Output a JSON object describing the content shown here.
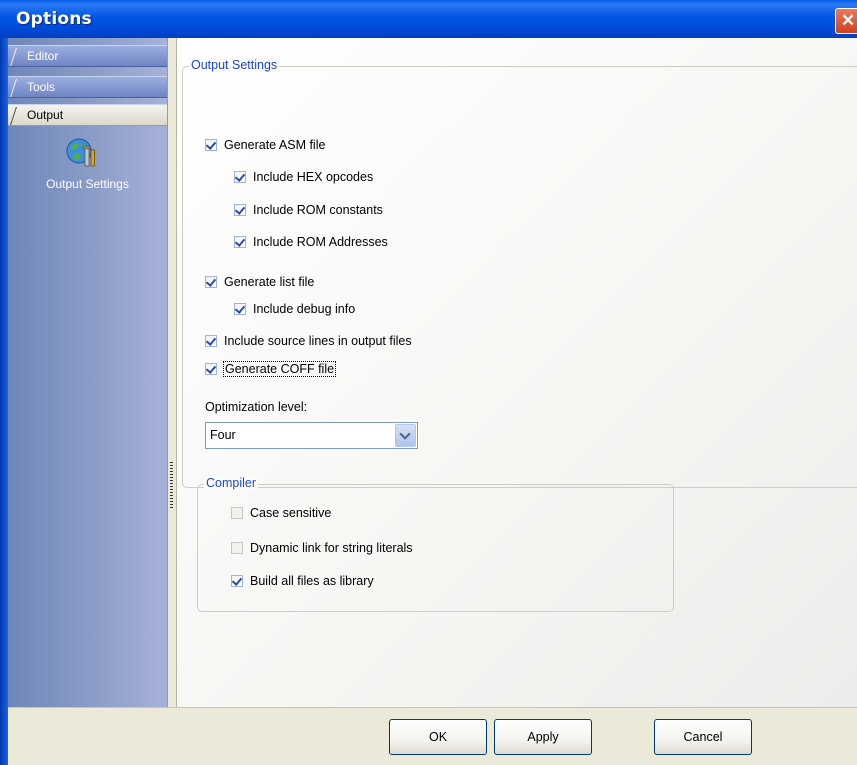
{
  "window": {
    "title": "Options",
    "close_glyph": "✕"
  },
  "sidebar": {
    "tabs": [
      {
        "label": "Editor",
        "active": false
      },
      {
        "label": "Tools",
        "active": false
      },
      {
        "label": "Output",
        "active": true
      }
    ],
    "items": [
      {
        "label": "Output Settings",
        "icon": "output-settings-icon"
      }
    ]
  },
  "output_settings": {
    "legend": "Output Settings",
    "checkboxes": [
      {
        "label": "Generate ASM file",
        "checked": true
      },
      {
        "label": "Include HEX opcodes",
        "checked": true
      },
      {
        "label": "Include ROM constants",
        "checked": true
      },
      {
        "label": "Include ROM Addresses",
        "checked": true
      },
      {
        "label": "Generate list file",
        "checked": true
      },
      {
        "label": "Include debug info",
        "checked": true
      },
      {
        "label": "Include source lines in output files",
        "checked": true
      },
      {
        "label": "Generate COFF file",
        "checked": true
      }
    ],
    "optimization_label": "Optimization level:",
    "optimization_value": "Four"
  },
  "compiler": {
    "legend": "Compiler",
    "checkboxes": [
      {
        "label": "Case sensitive",
        "checked": false
      },
      {
        "label": "Dynamic link for string literals",
        "checked": false
      },
      {
        "label": "Build all files as library",
        "checked": true
      }
    ]
  },
  "buttons": {
    "ok": "OK",
    "apply": "Apply",
    "cancel": "Cancel"
  },
  "colors": {
    "title_bar": "#0054e3",
    "group_legend": "#2347c5",
    "sidebar": "#8c9dc8"
  }
}
